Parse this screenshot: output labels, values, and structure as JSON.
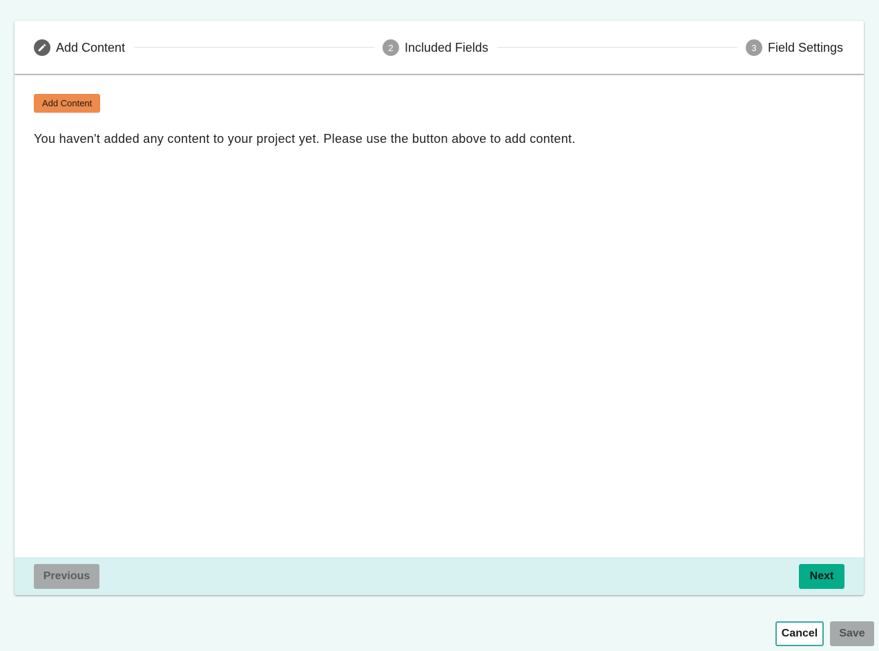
{
  "stepper": {
    "steps": [
      {
        "number": "",
        "label": "Add Content",
        "icon": "pencil-icon",
        "state": "active"
      },
      {
        "number": "2",
        "label": "Included Fields",
        "state": "pending"
      },
      {
        "number": "3",
        "label": "Field Settings",
        "state": "pending"
      }
    ]
  },
  "content": {
    "add_button_label": "Add Content",
    "empty_message": "You haven't added any content to your project yet. Please use the button above to add content."
  },
  "footer": {
    "previous_label": "Previous",
    "next_label": "Next"
  },
  "actions": {
    "cancel_label": "Cancel",
    "save_label": "Save"
  },
  "colors": {
    "page_background": "#effaf8",
    "add_button": "#ee8a4b",
    "next_button": "#04ac8a",
    "footer_background": "#d8f1f1",
    "disabled_button": "#a7aaab",
    "cancel_border": "#3aa7a0"
  }
}
